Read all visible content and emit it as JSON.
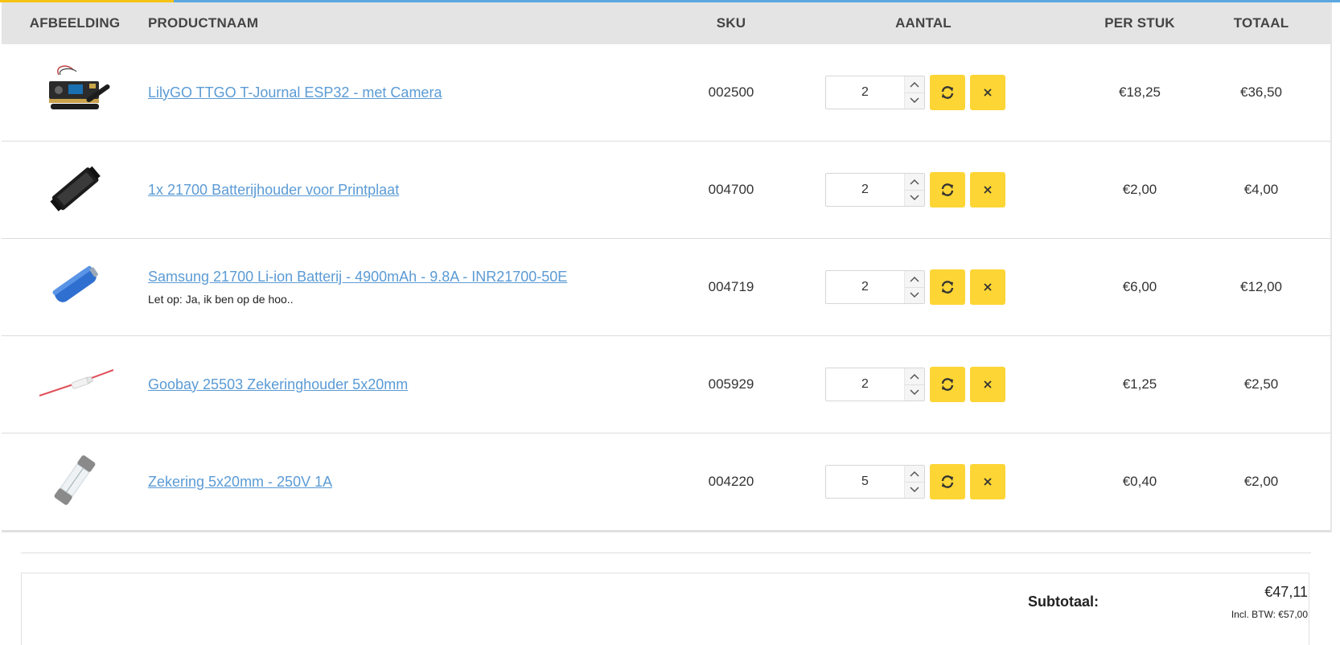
{
  "header": {
    "image": "AFBEELDING",
    "name": "PRODUCTNAAM",
    "sku": "SKU",
    "qty": "AANTAL",
    "unit": "PER STUK",
    "total": "TOTAAL"
  },
  "items": [
    {
      "name": "LilyGO TTGO T-Journal ESP32 - met Camera",
      "note": "",
      "sku": "002500",
      "qty": "2",
      "unit": "€18,25",
      "total": "€36,50"
    },
    {
      "name": "1x 21700 Batterijhouder voor Printplaat",
      "note": "",
      "sku": "004700",
      "qty": "2",
      "unit": "€2,00",
      "total": "€4,00"
    },
    {
      "name": "Samsung 21700 Li-ion Batterij - 4900mAh - 9.8A - INR21700-50E",
      "note": "Let op: Ja, ik ben op de hoo..",
      "sku": "004719",
      "qty": "2",
      "unit": "€6,00",
      "total": "€12,00"
    },
    {
      "name": "Goobay 25503 Zekeringhouder 5x20mm",
      "note": "",
      "sku": "005929",
      "qty": "2",
      "unit": "€1,25",
      "total": "€2,50"
    },
    {
      "name": "Zekering 5x20mm - 250V 1A",
      "note": "",
      "sku": "004220",
      "qty": "5",
      "unit": "€0,40",
      "total": "€2,00"
    }
  ],
  "summary": {
    "subtotal_label": "Subtotaal:",
    "subtotal_value": "€47,11",
    "incl_vat": "Incl. BTW: €57,00"
  },
  "icons": {
    "update": "refresh-icon",
    "remove": "close-icon",
    "spin_up": "chevron-up-icon",
    "spin_down": "chevron-down-icon"
  },
  "colors": {
    "accent_yellow": "#fdd535",
    "link_blue": "#5b9bd5",
    "header_bg": "#e4e4e4"
  }
}
